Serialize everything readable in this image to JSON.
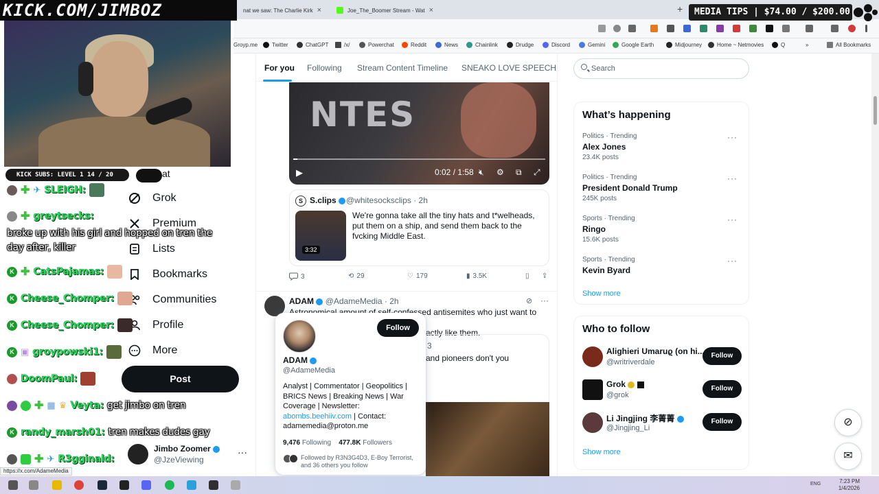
{
  "overlay": {
    "banner": "KICK.COM/JIMBOZ",
    "media_tips": "MEDIA TIPS | $74.00 / $200.00",
    "subs_label": "KICK SUBS: LEVEL 1",
    "subs_count": "14 / 20"
  },
  "chat": [
    {
      "name": "SLEIGH:",
      "msg": ""
    },
    {
      "name": "greytsecks:",
      "msg": ""
    },
    {
      "name": "CatsPajamas:",
      "msg": ""
    },
    {
      "name": "Cheese_Chomper:",
      "msg": ""
    },
    {
      "name": "Cheese_Chomper:",
      "msg": ""
    },
    {
      "name": "groypowski1:",
      "msg": ""
    },
    {
      "name": "DoomPaul:",
      "msg": ""
    },
    {
      "name": "Veyta:",
      "msg": "get jimbo on tren"
    },
    {
      "name": "randy_marsh01:",
      "msg": "tren makes dudes gay"
    },
    {
      "name": "R3gginald:",
      "msg": ""
    }
  ],
  "chat_multiline": "broke up with his girl and hopped on tren the day after, killer",
  "browser": {
    "tabs": [
      {
        "label": "nat we saw: The Charlie Kirk",
        "color": "#d33"
      },
      {
        "label": "Joe_The_Boomer Stream - Wat",
        "color": "#53fc18"
      }
    ],
    "bookmarks": [
      "Groyp.me",
      "Twitter",
      "ChatGPT",
      "/x/",
      "Powerchat",
      "Reddit",
      "News",
      "Chainlink",
      "Drudge",
      "Discord",
      "Gemini",
      "Google Earth",
      "Midjourney",
      "Home ~ Netmovies",
      "Q",
      "All Bookmarks"
    ],
    "status_url": "https://x.com/AdameMedia"
  },
  "nav": {
    "partial": "at",
    "items": [
      {
        "label": "Grok",
        "icon": "grok-icon"
      },
      {
        "label": "Premium",
        "icon": "x-logo-icon"
      },
      {
        "label": "Lists",
        "icon": "lists-icon"
      },
      {
        "label": "Bookmarks",
        "icon": "bookmark-icon"
      },
      {
        "label": "Communities",
        "icon": "communities-icon"
      },
      {
        "label": "Profile",
        "icon": "profile-icon"
      },
      {
        "label": "More",
        "icon": "more-circle-icon"
      }
    ],
    "post": "Post",
    "account_name": "Jimbo Zoomer",
    "account_handle": "@JzeViewing"
  },
  "timeline_tabs": [
    "For you",
    "Following",
    "Stream Content Timeline",
    "SNEAKO LOVE SPEECH"
  ],
  "video": {
    "overlay_text": "NTES",
    "time": "0:02 / 1:58",
    "progress": 0.017
  },
  "quote": {
    "name": "S.clips",
    "handle": "@whitesocksclips · 2h",
    "duration": "3:32",
    "text": "We're gonna take all the tiny hats and t*welheads, put them on a ship, and send them back to the fvcking Middle East."
  },
  "actions": {
    "replies": "3",
    "reposts": "29",
    "likes": "179",
    "views": "3.5K"
  },
  "tweet2": {
    "name": "ADAM",
    "handle": "@AdameMedia · 2h",
    "text_line1": "Astronomical amount of self-confessed antisemites who just want to do",
    "text_line2": "actly like them.",
    "quote_text": "and pioneers don't you",
    "quote_meta": "3"
  },
  "hover_card": {
    "follow": "Follow",
    "name": "ADAM",
    "handle": "@AdameMedia",
    "bio": "Analyst | Commentator | Geopolitics | BRICS News | Breaking News | War Coverage | Newsletter:",
    "link": "abombs.beehiiv.com",
    "contact": " | Contact: adamemedia@proton.me",
    "following_count": "9,476",
    "following_label": "Following",
    "followers_count": "477.8K",
    "followers_label": "Followers",
    "followed_by": "Followed by R3N3G4D3, E-Boy Terrorist, and 36 others you follow"
  },
  "sidebar": {
    "search_placeholder": "Search",
    "happening_title": "What’s happening",
    "trends": [
      {
        "category": "Politics · Trending",
        "title": "Alex Jones",
        "count": "23.4K posts"
      },
      {
        "category": "Politics · Trending",
        "title": "President Donald Trump",
        "count": "245K posts"
      },
      {
        "category": "Sports · Trending",
        "title": "Ringo",
        "count": "15.6K posts"
      },
      {
        "category": "Sports · Trending",
        "title": "Kevin Byard",
        "count": ""
      }
    ],
    "show_more": "Show more",
    "wtf_title": "Who to follow",
    "wtf": [
      {
        "name": "Alighieri Umaruϱ (on hi...",
        "handle": "@writriverdale",
        "follow": "Follow",
        "color": "#7a2a1a"
      },
      {
        "name": "Grok",
        "handle": "@grok",
        "follow": "Follow",
        "color": "#111111"
      },
      {
        "name": "Li Jingjing 李菁菁",
        "handle": "@Jingjing_Li",
        "follow": "Follow",
        "color": "#5a3a3a"
      }
    ]
  },
  "taskbar": {
    "time": "7:23 PM",
    "date": "1/4/2026",
    "lang": "ENG"
  }
}
